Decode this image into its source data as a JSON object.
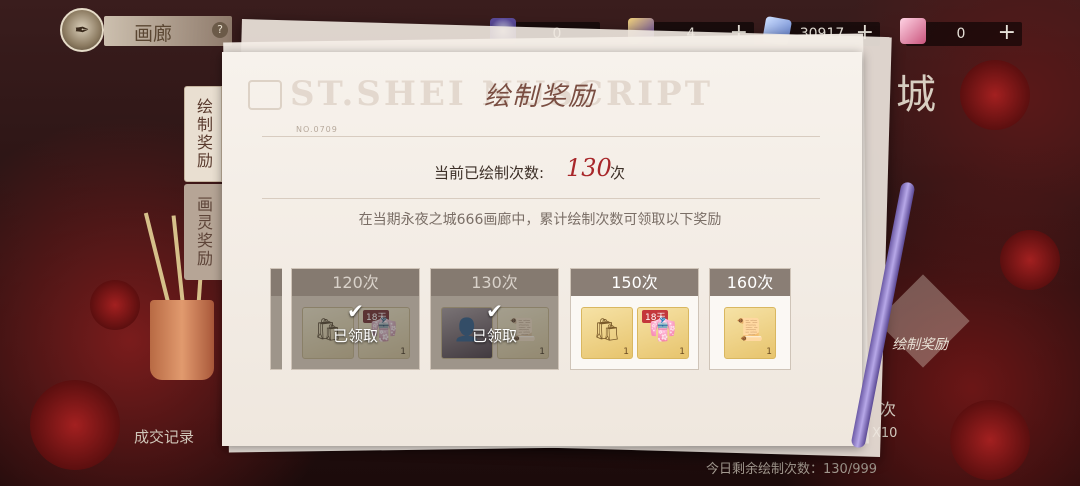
{
  "header": {
    "title": "画廊",
    "help_icon": "?",
    "resources": [
      {
        "icon": "rose-gem-icon",
        "value": "0",
        "has_plus": false
      },
      {
        "icon": "easel-icon",
        "value": "4",
        "has_plus": true
      },
      {
        "icon": "diamond-icon",
        "value": "30917",
        "has_plus": true
      },
      {
        "icon": "pink-crystal-icon",
        "value": "0",
        "has_plus": true
      }
    ]
  },
  "side_tabs": [
    {
      "label": "绘制奖励",
      "active": true
    },
    {
      "label": "画灵奖励",
      "active": false
    }
  ],
  "panel": {
    "watermark": "ST.SHEI    NUSCRIPT",
    "serial": "NO.0709",
    "title": "绘制奖励",
    "count_label": "当前已绘制次数:",
    "count_value": "130",
    "count_unit": "次",
    "description": "在当期永夜之城666画廊中，累计绘制次数可领取以下奖励"
  },
  "rewards": [
    {
      "label": "120次",
      "claimed": true,
      "claimed_text": "已领取",
      "items": [
        {
          "icon": "gift-bag-icon",
          "qty": ""
        },
        {
          "icon": "outfit-icon",
          "qty": "1",
          "timer": "18天"
        }
      ]
    },
    {
      "label": "130次",
      "claimed": true,
      "claimed_text": "已领取",
      "items": [
        {
          "icon": "character-portrait-icon",
          "qty": ""
        },
        {
          "icon": "scroll-icon",
          "qty": "1"
        }
      ]
    },
    {
      "label": "150次",
      "claimed": false,
      "items": [
        {
          "icon": "gift-bag-icon",
          "qty": "1"
        },
        {
          "icon": "outfit-icon",
          "qty": "1",
          "timer": "18天"
        }
      ]
    },
    {
      "label": "160次",
      "claimed": false,
      "items": [
        {
          "icon": "scroll-icon",
          "qty": "1"
        }
      ]
    }
  ],
  "right_side": {
    "title_char": "城",
    "draw_reward_button": "绘制奖励",
    "ci_label": "次",
    "x10": "X10"
  },
  "bottom": {
    "left_label": "成交记录",
    "status": "今日剩余绘制次数：130/999"
  },
  "colors": {
    "accent_red": "#a8272a",
    "paper": "#f7f2ec",
    "claimed_overlay": "#9e958a"
  }
}
